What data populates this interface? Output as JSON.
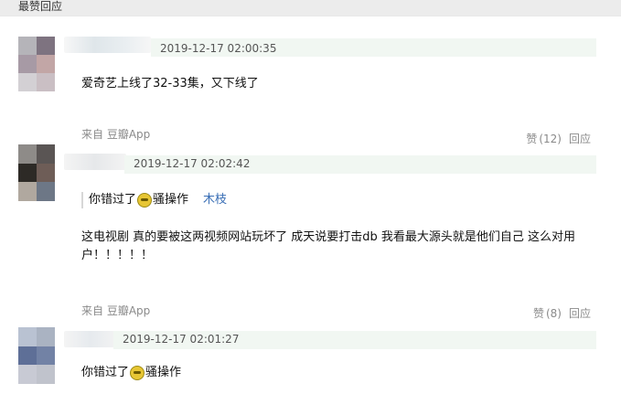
{
  "header": {
    "title": "最赞回应"
  },
  "comments": [
    {
      "timestamp": "2019-12-17 02:00:35",
      "text": "爱奇艺上线了32-33集，又下线了",
      "source": "来自 豆瓣App",
      "like_label": "赞",
      "like_count": "(12)",
      "reply_label": "回应"
    },
    {
      "timestamp": "2019-12-17 02:02:42",
      "quote_prefix": "你错过了",
      "quote_suffix": "骚操作",
      "quote_author": "木枝",
      "text": "这电视剧 真的要被这两视频网站玩坏了 成天说要打击db 我看最大源头就是他们自己 这么对用户！！！！！",
      "source": "来自 豆瓣App",
      "like_label": "赞",
      "like_count": "(8)",
      "reply_label": "回应"
    },
    {
      "timestamp": "2019-12-17 02:01:27",
      "text_prefix": "你错过了",
      "text_suffix": "骚操作"
    }
  ],
  "colors": {
    "meta_bar": "#f1f7f2",
    "link": "#3a6fb6",
    "muted": "#8a8a8a",
    "header_bg": "#ececec"
  },
  "icons": {
    "emoji": "doge-emoji-icon"
  }
}
